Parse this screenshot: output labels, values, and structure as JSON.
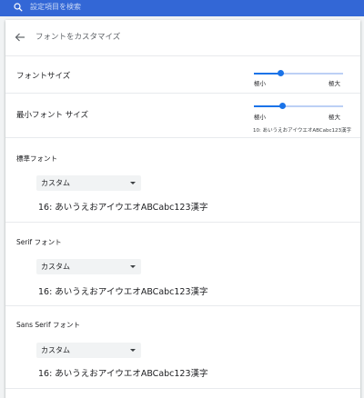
{
  "search": {
    "placeholder": "設定項目を検索"
  },
  "header": {
    "title": "フォントをカスタマイズ"
  },
  "font_size": {
    "label": "フォントサイズ",
    "min_label": "極小",
    "max_label": "極大",
    "value_fraction": 0.3
  },
  "min_font_size": {
    "label": "最小フォント サイズ",
    "min_label": "極小",
    "max_label": "極大",
    "value_fraction": 0.32,
    "preview": "10: あいうえおアイウエオABCabc123漢字"
  },
  "standard_font": {
    "title": "標準フォント",
    "selected": "カスタム",
    "sample": "16: あいうえおアイウエオABCabc123漢字"
  },
  "serif_font": {
    "title": "Serif フォント",
    "selected": "カスタム",
    "sample": "16: あいうえおアイウエオABCabc123漢字"
  },
  "sans_serif_font": {
    "title": "Sans Serif フォント",
    "selected": "カスタム",
    "sample": "16: あいうえおアイウエオABCabc123漢字"
  },
  "colors": {
    "topbar": "#3367d6",
    "accent": "#1a73e8"
  }
}
